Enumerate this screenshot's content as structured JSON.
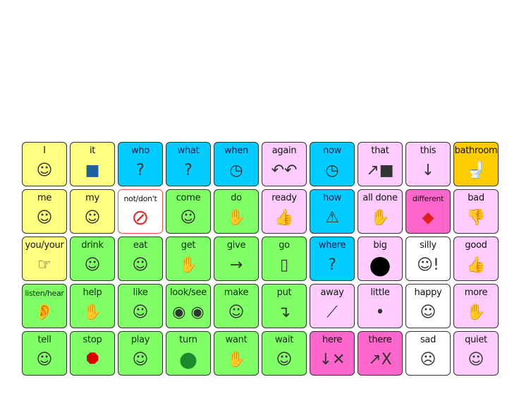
{
  "colors": {
    "yellow": "#ffff80",
    "blue": "#00ccff",
    "green": "#80ff66",
    "pink": "#ffccff",
    "hotpink": "#ff66cc",
    "orange": "#ffcc00",
    "white": "#ffffff"
  },
  "cells": [
    {
      "label": "I",
      "color": "yellow",
      "icon": "person-pointing-self-icon",
      "glyph": "☺"
    },
    {
      "label": "it",
      "color": "yellow",
      "icon": "blue-square-arrow-icon",
      "glyph": "■"
    },
    {
      "label": "who",
      "color": "blue",
      "icon": "head-question-icon",
      "glyph": "?"
    },
    {
      "label": "what",
      "color": "blue",
      "icon": "box-question-icon",
      "glyph": "?"
    },
    {
      "label": "when",
      "color": "blue",
      "icon": "clock-question-icon",
      "glyph": "◷"
    },
    {
      "label": "again",
      "color": "pink",
      "icon": "double-arrow-icon",
      "glyph": "↶↶"
    },
    {
      "label": "now",
      "color": "blue",
      "icon": "clock-person-icon",
      "glyph": "◷"
    },
    {
      "label": "that",
      "color": "pink",
      "icon": "arrow-to-square-icon",
      "glyph": "↗■"
    },
    {
      "label": "this",
      "color": "pink",
      "icon": "arrow-down-square-icon",
      "glyph": "↓"
    },
    {
      "label": "bathroom",
      "color": "orange",
      "icon": "toilet-icon",
      "glyph": "🚽"
    },
    {
      "label": "me",
      "color": "yellow",
      "icon": "person-self-icon",
      "glyph": "☺"
    },
    {
      "label": "my",
      "color": "yellow",
      "icon": "person-square-icon",
      "glyph": "☺"
    },
    {
      "label": "not/don't",
      "color": "white",
      "icon": "prohibited-icon",
      "glyph": "⃠"
    },
    {
      "label": "come",
      "color": "green",
      "icon": "person-beckon-icon",
      "glyph": "☺"
    },
    {
      "label": "do",
      "color": "green",
      "icon": "hands-doing-icon",
      "glyph": "✋"
    },
    {
      "label": "ready",
      "color": "pink",
      "icon": "person-thumbs-up-icon",
      "glyph": "👍"
    },
    {
      "label": "how",
      "color": "blue",
      "icon": "triangle-question-icon",
      "glyph": "⚠"
    },
    {
      "label": "all done",
      "color": "pink",
      "icon": "hands-finished-icon",
      "glyph": "✋"
    },
    {
      "label": "different",
      "color": "hotpink",
      "icon": "oval-diamond-icon",
      "glyph": "◆"
    },
    {
      "label": "bad",
      "color": "pink",
      "icon": "thumbs-down-icon",
      "glyph": "👎"
    },
    {
      "label": "you/your",
      "color": "yellow",
      "icon": "person-pointing-icon",
      "glyph": "☞"
    },
    {
      "label": "drink",
      "color": "green",
      "icon": "person-drinking-icon",
      "glyph": "☺"
    },
    {
      "label": "eat",
      "color": "green",
      "icon": "person-eating-icon",
      "glyph": "☺"
    },
    {
      "label": "get",
      "color": "green",
      "icon": "hand-get-icon",
      "glyph": "✋"
    },
    {
      "label": "give",
      "color": "green",
      "icon": "people-giving-icon",
      "glyph": "→"
    },
    {
      "label": "go",
      "color": "green",
      "icon": "traffic-light-icon",
      "glyph": "▯"
    },
    {
      "label": "where",
      "color": "blue",
      "icon": "arrows-question-icon",
      "glyph": "?"
    },
    {
      "label": "big",
      "color": "pink",
      "icon": "big-blob-icon",
      "glyph": "●"
    },
    {
      "label": "silly",
      "color": "white",
      "icon": "silly-face-icon",
      "glyph": "☺!"
    },
    {
      "label": "good",
      "color": "pink",
      "icon": "thumbs-up-icon",
      "glyph": "👍"
    },
    {
      "label": "listen/hear",
      "color": "green",
      "icon": "ear-icon",
      "glyph": "👂"
    },
    {
      "label": "help",
      "color": "green",
      "icon": "hands-helping-icon",
      "glyph": "✋"
    },
    {
      "label": "like",
      "color": "green",
      "icon": "face-like-icon",
      "glyph": "☺"
    },
    {
      "label": "look/see",
      "color": "green",
      "icon": "eyes-icon",
      "glyph": "◉ ◉"
    },
    {
      "label": "make",
      "color": "green",
      "icon": "person-making-icon",
      "glyph": "☺"
    },
    {
      "label": "put",
      "color": "green",
      "icon": "hand-put-icon",
      "glyph": "↴"
    },
    {
      "label": "away",
      "color": "pink",
      "icon": "lines-away-icon",
      "glyph": "⟋"
    },
    {
      "label": "little",
      "color": "pink",
      "icon": "small-dot-icon",
      "glyph": "•"
    },
    {
      "label": "happy",
      "color": "white",
      "icon": "happy-face-icon",
      "glyph": "☺"
    },
    {
      "label": "more",
      "color": "pink",
      "icon": "hands-more-icon",
      "glyph": "✋"
    },
    {
      "label": "tell",
      "color": "green",
      "icon": "face-speaking-icon",
      "glyph": "☺"
    },
    {
      "label": "stop",
      "color": "green",
      "icon": "stop-sign-icon",
      "glyph": "⯃"
    },
    {
      "label": "play",
      "color": "green",
      "icon": "child-playing-icon",
      "glyph": "☺"
    },
    {
      "label": "turn",
      "color": "green",
      "icon": "turn-circle-icon",
      "glyph": "●"
    },
    {
      "label": "want",
      "color": "green",
      "icon": "hands-want-icon",
      "glyph": "✋"
    },
    {
      "label": "wait",
      "color": "green",
      "icon": "people-waiting-icon",
      "glyph": "☺"
    },
    {
      "label": "here",
      "color": "hotpink",
      "icon": "arrow-here-icon",
      "glyph": "↓✕"
    },
    {
      "label": "there",
      "color": "hotpink",
      "icon": "arrow-there-icon",
      "glyph": "↗X"
    },
    {
      "label": "sad",
      "color": "white",
      "icon": "sad-face-icon",
      "glyph": "☹"
    },
    {
      "label": "quiet",
      "color": "pink",
      "icon": "face-shush-icon",
      "glyph": "☺"
    }
  ]
}
